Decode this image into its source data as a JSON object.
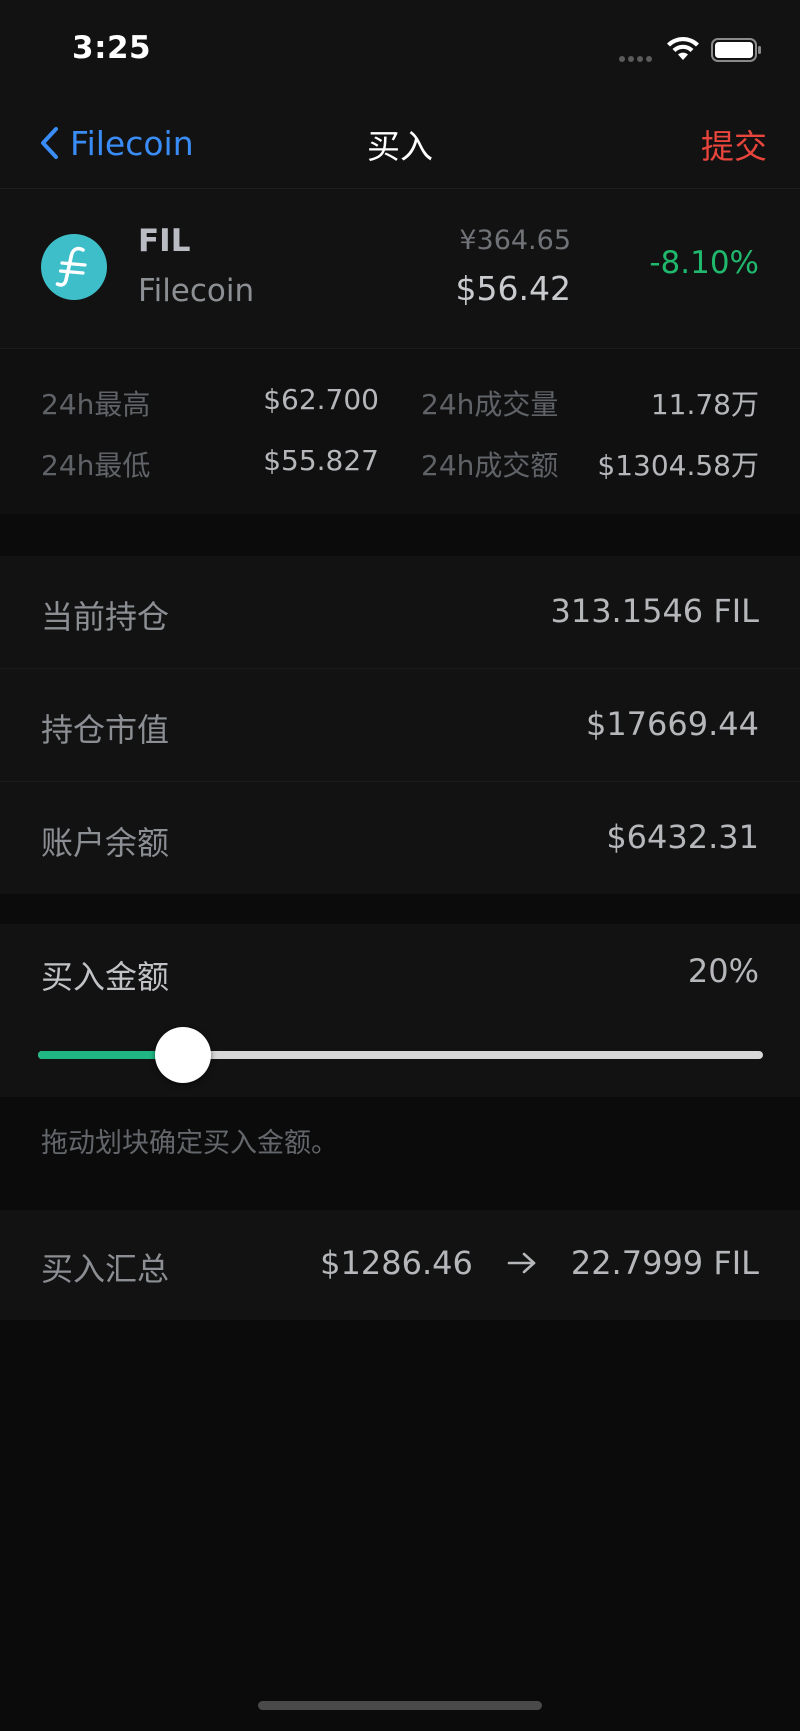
{
  "status_bar": {
    "time": "3:25"
  },
  "nav": {
    "back_label": "Filecoin",
    "title": "买入",
    "submit_label": "提交"
  },
  "coin": {
    "symbol": "FIL",
    "name": "Filecoin",
    "price_cny": "¥364.65",
    "price_usd": "$56.42",
    "change": "-8.10%",
    "logo_color": "#3ebec8"
  },
  "stats": {
    "high_label": "24h最高",
    "high_value": "$62.700",
    "low_label": "24h最低",
    "low_value": "$55.827",
    "volume_label": "24h成交量",
    "volume_value": "11.78万",
    "turnover_label": "24h成交额",
    "turnover_value": "$1304.58万"
  },
  "holdings": {
    "position_label": "当前持仓",
    "position_value": "313.1546 FIL",
    "market_value_label": "持仓市值",
    "market_value_value": "$17669.44",
    "balance_label": "账户余额",
    "balance_value": "$6432.31"
  },
  "buy": {
    "label": "买入金额",
    "percent_label": "20%",
    "slider_fraction": 0.2,
    "hint": "拖动划块确定买入金额。"
  },
  "summary": {
    "label": "买入汇总",
    "amount": "$1286.46",
    "quantity": "22.7999 FIL"
  },
  "colors": {
    "accent_blue": "#3a8cf6",
    "submit_red": "#e8453c",
    "change_green": "#1fb86d",
    "slider_green": "#1fb884"
  }
}
